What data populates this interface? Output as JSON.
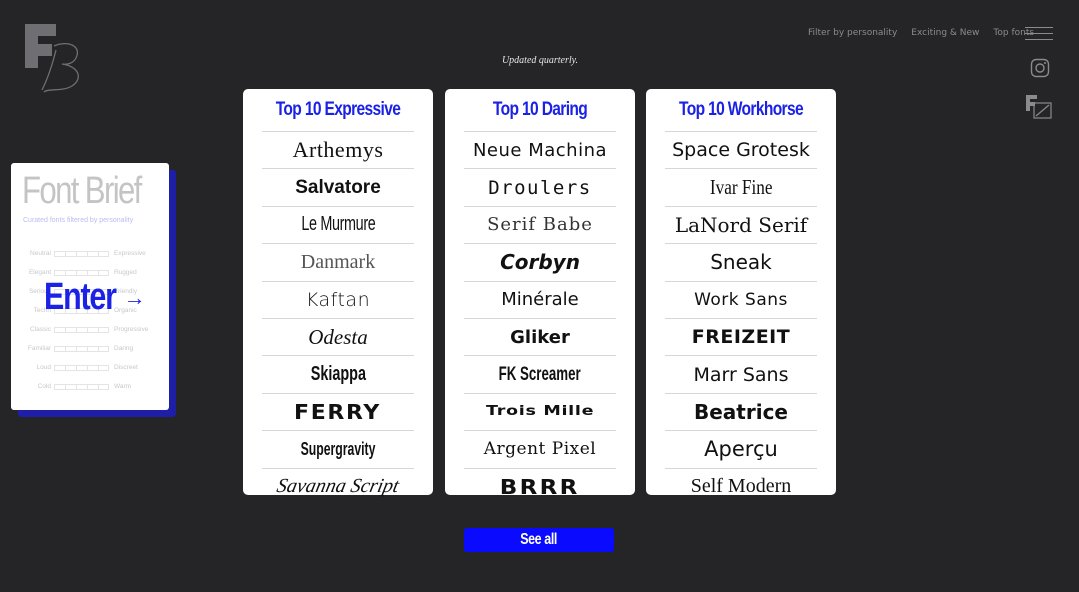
{
  "nav": {
    "links": [
      "Filter by personality",
      "Exciting & New",
      "Top fonts"
    ]
  },
  "tagline": "Updated quarterly.",
  "preview": {
    "title": "Font Brief",
    "subtitle": "Curated fonts filtered by personality",
    "sliders": [
      {
        "left": "Neutral",
        "right": "Expressive"
      },
      {
        "left": "Elegant",
        "right": "Rugged"
      },
      {
        "left": "Serious",
        "right": "Friendly"
      },
      {
        "left": "Techn",
        "right": "Organic"
      },
      {
        "left": "Classic",
        "right": "Progressive"
      },
      {
        "left": "Familiar",
        "right": "Daring"
      },
      {
        "left": "Loud",
        "right": "Discreet"
      },
      {
        "left": "Cold",
        "right": "Warm"
      }
    ],
    "enter_label": "Enter",
    "enter_arrow": "→"
  },
  "lists": [
    {
      "title": "Top 10 Expressive",
      "fonts": [
        "Arthemys",
        "Salvatore",
        "Le Murmure",
        "Danmark",
        "Kaftan",
        "Odesta",
        "Skiappa",
        "FERRY",
        "Supergravity",
        "Savanna Script"
      ]
    },
    {
      "title": "Top 10 Daring",
      "fonts": [
        "Neue Machina",
        "Droulers",
        "Serif Babe",
        "Corbyn",
        "Minérale",
        "Gliker",
        "FK Screamer",
        "Trois Mille",
        "Argent Pixel",
        "BRRR"
      ]
    },
    {
      "title": "Top 10 Workhorse",
      "fonts": [
        "Space Grotesk",
        "Ivar Fine",
        "LaNord Serif",
        "Sneak",
        "Work Sans",
        "FREIZEIT",
        "Marr Sans",
        "Beatrice",
        "Aperçu",
        "Self Modern"
      ]
    }
  ],
  "see_all_label": "See all",
  "colors": {
    "background": "#252528",
    "accent": "#0a0aff",
    "title_blue": "#1b22e6",
    "card": "#ffffff"
  },
  "icons": [
    "menu-icon",
    "instagram-icon",
    "fontbrief-icon"
  ]
}
